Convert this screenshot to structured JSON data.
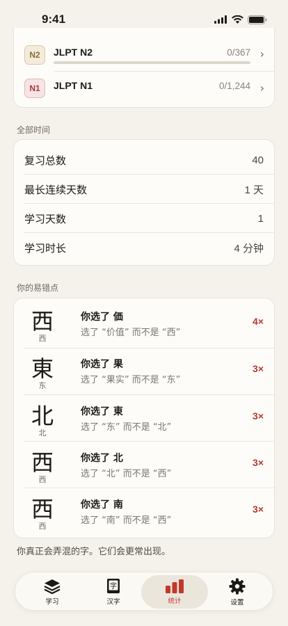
{
  "status": {
    "time": "9:41"
  },
  "jlpt": [
    {
      "badge": "N2",
      "name": "JLPT N2",
      "count": "0/367",
      "progress": 0
    },
    {
      "badge": "N1",
      "name": "JLPT N1",
      "count": "0/1,244",
      "progress": 0
    }
  ],
  "all_time": {
    "label": "全部时间",
    "rows": [
      {
        "label": "复习总数",
        "value": "40"
      },
      {
        "label": "最长连续天数",
        "value": "1 天"
      },
      {
        "label": "学习天数",
        "value": "1"
      },
      {
        "label": "学习时长",
        "value": "4 分钟"
      }
    ]
  },
  "mistakes": {
    "label": "你的易错点",
    "rows": [
      {
        "kanji": "西",
        "simplified": "西",
        "title": "你选了 価",
        "sub": "选了 “价值” 而不是 “西”",
        "count": "4×"
      },
      {
        "kanji": "東",
        "simplified": "东",
        "title": "你选了 果",
        "sub": "选了 “果实” 而不是 “东”",
        "count": "3×"
      },
      {
        "kanji": "北",
        "simplified": "北",
        "title": "你选了 東",
        "sub": "选了 “东” 而不是 “北”",
        "count": "3×"
      },
      {
        "kanji": "西",
        "simplified": "西",
        "title": "你选了 北",
        "sub": "选了 “北” 而不是 “西”",
        "count": "3×"
      },
      {
        "kanji": "西",
        "simplified": "西",
        "title": "你选了 南",
        "sub": "选了 “南” 而不是 “西”",
        "count": "3×"
      }
    ],
    "footnote": "你真正会弄混的字。它们会更常出现。"
  },
  "tabs": [
    {
      "label": "学习",
      "icon": "layers-icon",
      "active": false
    },
    {
      "label": "汉字",
      "icon": "kanji-book-icon",
      "active": false
    },
    {
      "label": "统计",
      "icon": "bar-chart-icon",
      "active": true
    },
    {
      "label": "设置",
      "icon": "gear-icon",
      "active": false
    }
  ],
  "colors": {
    "accent": "#c0392b",
    "mistake": "#b23a32",
    "background": "#f5f2ec"
  }
}
